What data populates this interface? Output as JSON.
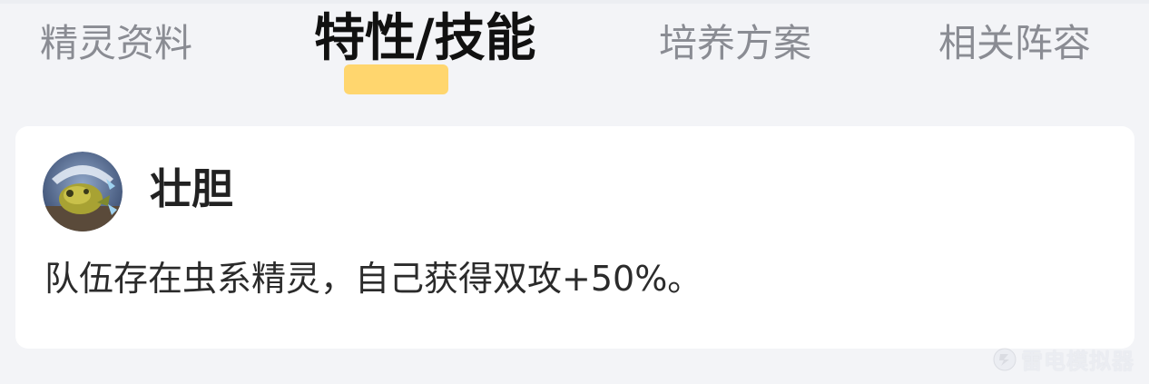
{
  "tabs": [
    {
      "label": "精灵资料"
    },
    {
      "label": "特性/技能"
    },
    {
      "label": "培养方案"
    },
    {
      "label": "相关阵容"
    }
  ],
  "active_tab_index": 1,
  "colors": {
    "accent": "#ffd66e",
    "background": "#f3f4f7",
    "card": "#ffffff",
    "inactive_tab": "#8a8c93",
    "active_tab": "#111111"
  },
  "ability": {
    "icon": "bug-creature-avatar-icon",
    "name": "壮胆",
    "description": "队伍存在虫系精灵，自己获得双攻+50%。"
  },
  "watermark": {
    "icon": "emulator-logo-icon",
    "text": "雷电模拟器"
  }
}
